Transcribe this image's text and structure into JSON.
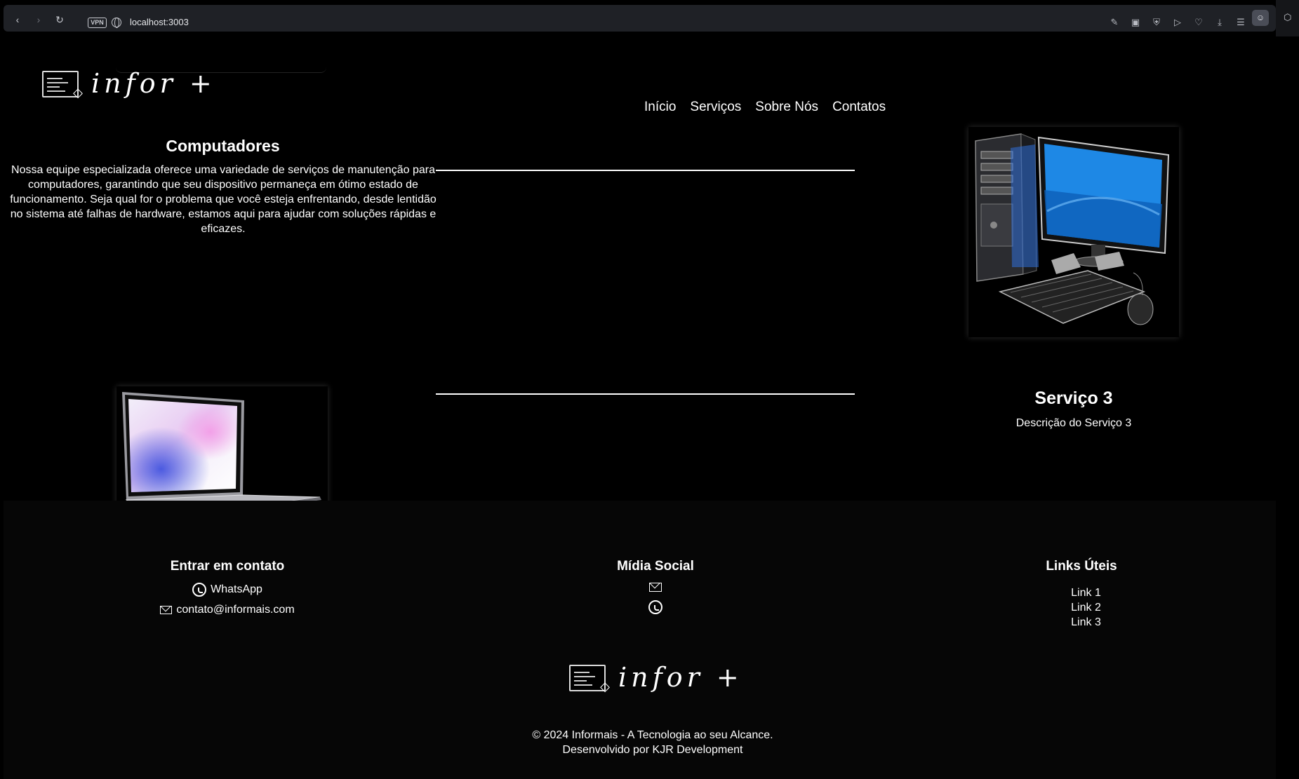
{
  "browser": {
    "url": "localhost:3003",
    "vpn_label": "VPN"
  },
  "header": {
    "nav": [
      "Início",
      "Serviços",
      "Sobre Nós",
      "Contatos"
    ]
  },
  "services": {
    "service1": {
      "title": "Computadores",
      "description": "Nossa equipe especializada oferece uma variedade de serviços de manutenção para computadores, garantindo que seu dispositivo permaneça em ótimo estado de funcionamento. Seja qual for o problema que você esteja enfrentando, desde lentidão no sistema até falhas de hardware, estamos aqui para ajudar com soluções rápidas e eficazes."
    },
    "service3": {
      "title": "Serviço 3",
      "description": "Descrição do Serviço 3"
    }
  },
  "footer": {
    "contact": {
      "heading": "Entrar em contato",
      "whatsapp": "WhatsApp",
      "email": "contato@informais.com"
    },
    "social": {
      "heading": "Mídia Social"
    },
    "links": {
      "heading": "Links Úteis",
      "items": [
        "Link 1",
        "Link 2",
        "Link 3"
      ]
    },
    "copyright": "© 2024 Informais - A Tecnologia ao seu Alcance.",
    "developer": "Desenvolvido por KJR Development"
  }
}
